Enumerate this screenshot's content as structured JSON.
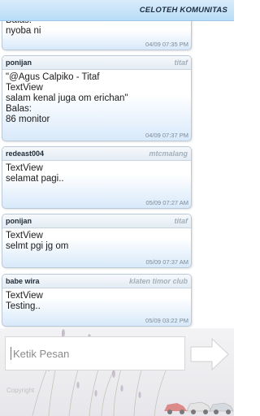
{
  "header": {
    "title": "CELOTEH KOMUNITAS"
  },
  "messages": [
    {
      "sender": "",
      "community": "",
      "text": "Balas:\nnyoba ni",
      "time": "04/09 07:35 PM"
    },
    {
      "sender": "ponijan",
      "community": "titaf",
      "text": "\"@Agus Calpiko - Titaf\nTextView\nsalam kenal juga om erichan\"\nBalas:\n86 monitor",
      "time": "04/09 07:37 PM"
    },
    {
      "sender": "redeast004",
      "community": "mtcmalang",
      "text": "TextView\nselamat pagi..",
      "time": "05/09 07:27 AM"
    },
    {
      "sender": "ponijan",
      "community": "titaf",
      "text": "TextView\nselmt pgi jg om",
      "time": "05/09 07:37 AM"
    },
    {
      "sender": "babe wira",
      "community": "klaten timor club",
      "text": "TextView\nTesting..",
      "time": "05/09 03:22 PM"
    }
  ],
  "compose": {
    "placeholder": "Ketik Pesan",
    "copyright": "Copyright"
  },
  "icons": {
    "send": "send-arrow-icon",
    "background": "dried-flowers-background",
    "cars": "cars-logo"
  },
  "colors": {
    "header_bg": "#c6e2f8",
    "card_gradient_bottom": "#d8e9fa",
    "community_text": "#a3afba"
  }
}
